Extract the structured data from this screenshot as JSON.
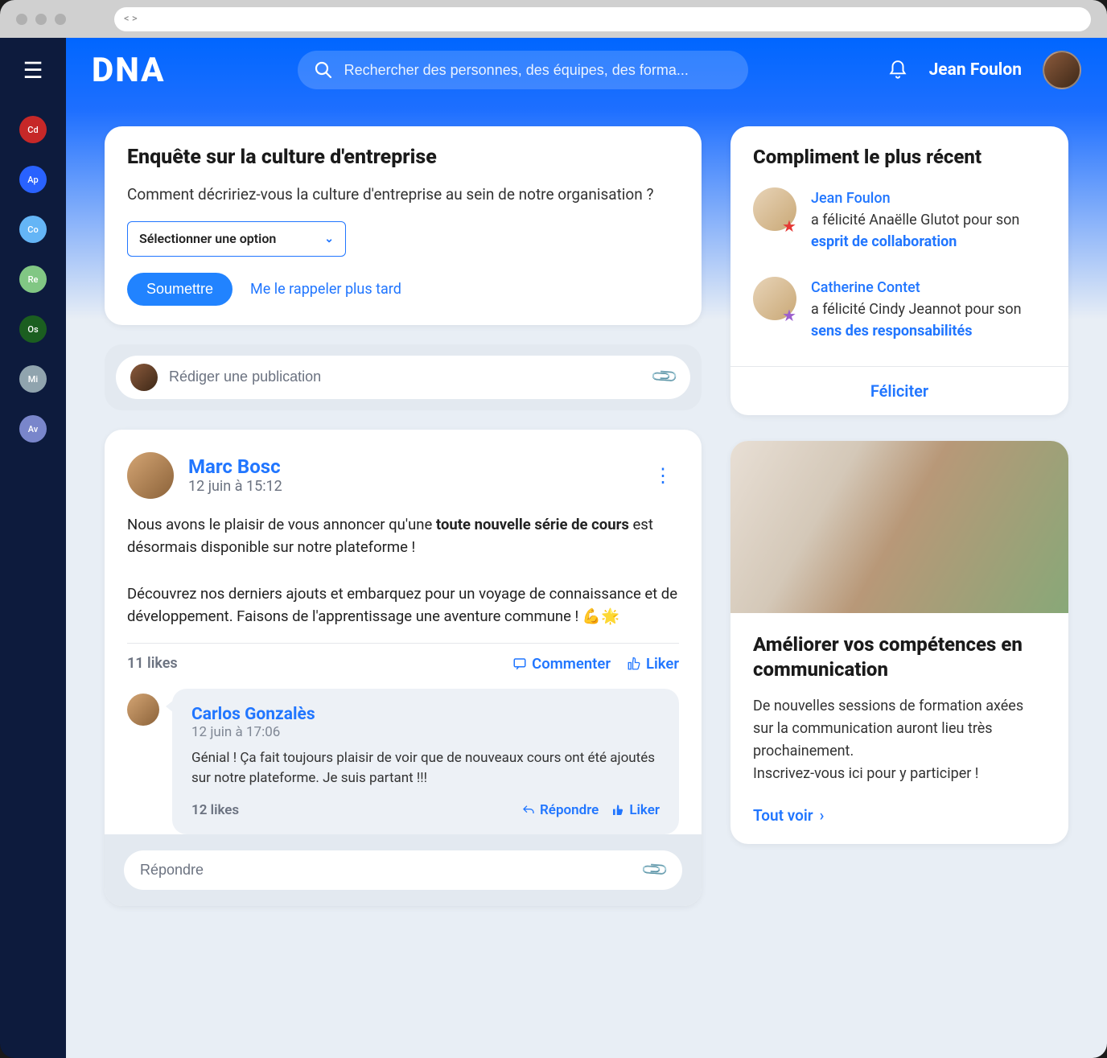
{
  "brand": "DNA",
  "search": {
    "placeholder": "Rechercher des personnes, des équipes, des forma..."
  },
  "current_user": {
    "name": "Jean Foulon"
  },
  "rail_items": [
    {
      "initials": "Cd",
      "color": "#c62828"
    },
    {
      "initials": "Ap",
      "color": "#2962ff"
    },
    {
      "initials": "Co",
      "color": "#64b5f6"
    },
    {
      "initials": "Re",
      "color": "#81c784"
    },
    {
      "initials": "Os",
      "color": "#1b5e20"
    },
    {
      "initials": "Mi",
      "color": "#90a4ae"
    },
    {
      "initials": "Av",
      "color": "#7986cb"
    }
  ],
  "survey": {
    "title": "Enquête sur la culture d'entreprise",
    "question": "Comment décririez-vous la culture d'entreprise au sein de notre organisation ?",
    "select_placeholder": "Sélectionner une option",
    "submit_label": "Soumettre",
    "remind_label": "Me le rappeler plus tard"
  },
  "compose": {
    "placeholder": "Rédiger une publication"
  },
  "post": {
    "author": "Marc Bosc",
    "date": "12 juin à 15:12",
    "body_intro": "Nous avons le plaisir de vous annoncer qu'une ",
    "body_bold": "toute nouvelle série de cours",
    "body_after_bold": " est désormais disponible sur notre plateforme !",
    "body_para2": "Découvrez nos derniers ajouts et embarquez pour un voyage de connaissance et de développement. Faisons de l'apprentissage une aventure commune ! 💪🌟",
    "likes": "11 likes",
    "comment_label": "Commenter",
    "like_label": "Liker"
  },
  "comment": {
    "author": "Carlos Gonzalès",
    "date": "12 juin à 17:06",
    "text": "Génial ! Ça fait toujours plaisir de voir que de nouveaux cours ont été ajoutés sur notre plateforme. Je suis partant !!!",
    "likes": "12 likes",
    "reply_label": "Répondre",
    "like_label": "Liker"
  },
  "reply": {
    "placeholder": "Répondre"
  },
  "compliments": {
    "title": "Compliment le plus récent",
    "items": [
      {
        "from": "Jean Foulon",
        "verb": "a félicité Anaëlle Glutot pour son ",
        "quality": "esprit de collaboration",
        "star_color": "#e53935"
      },
      {
        "from": "Catherine Contet",
        "verb": "a félicité Cindy Jeannot pour son ",
        "quality": "sens des responsabilités",
        "star_color": "#9c5fce"
      }
    ],
    "action": "Féliciter"
  },
  "training": {
    "title": "Améliorer vos compétences en communication",
    "desc_line1": "De nouvelles sessions de formation axées sur la communication auront lieu très prochainement.",
    "desc_line2": "Inscrivez-vous ici pour y participer !",
    "link": "Tout voir"
  }
}
